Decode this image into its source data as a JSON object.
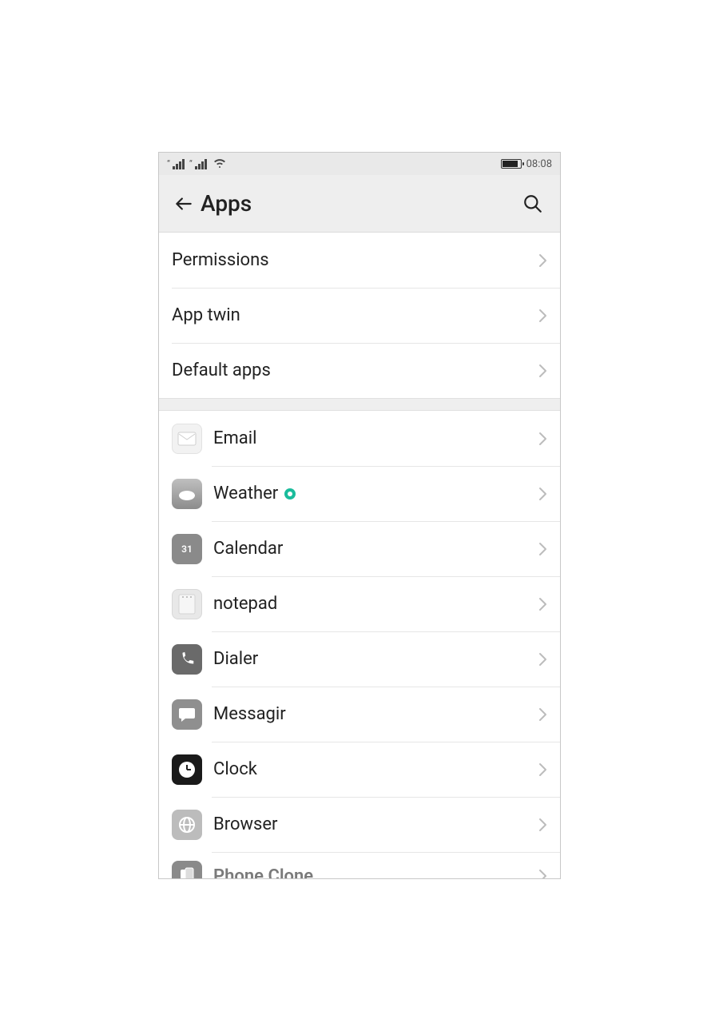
{
  "status": {
    "time": "08:08"
  },
  "header": {
    "title": "Apps"
  },
  "settings": [
    {
      "label": "Permissions"
    },
    {
      "label": "App twin"
    },
    {
      "label": "Default apps"
    }
  ],
  "apps": [
    {
      "label": "Email",
      "icon": "email-icon",
      "badge": false
    },
    {
      "label": "Weather",
      "icon": "weather-icon",
      "badge": true
    },
    {
      "label": "Calendar",
      "icon": "calendar-icon",
      "badge": false
    },
    {
      "label": "notepad",
      "icon": "notepad-icon",
      "badge": false
    },
    {
      "label": "Dialer",
      "icon": "dialer-icon",
      "badge": false
    },
    {
      "label": "Messagir",
      "icon": "messaging-icon",
      "badge": false
    },
    {
      "label": "Clock",
      "icon": "clock-icon",
      "badge": false
    },
    {
      "label": "Browser",
      "icon": "browser-icon",
      "badge": false
    },
    {
      "label": "Phone Clone",
      "icon": "phone-clone-icon",
      "badge": false
    }
  ],
  "calendar_icon_text": "31"
}
